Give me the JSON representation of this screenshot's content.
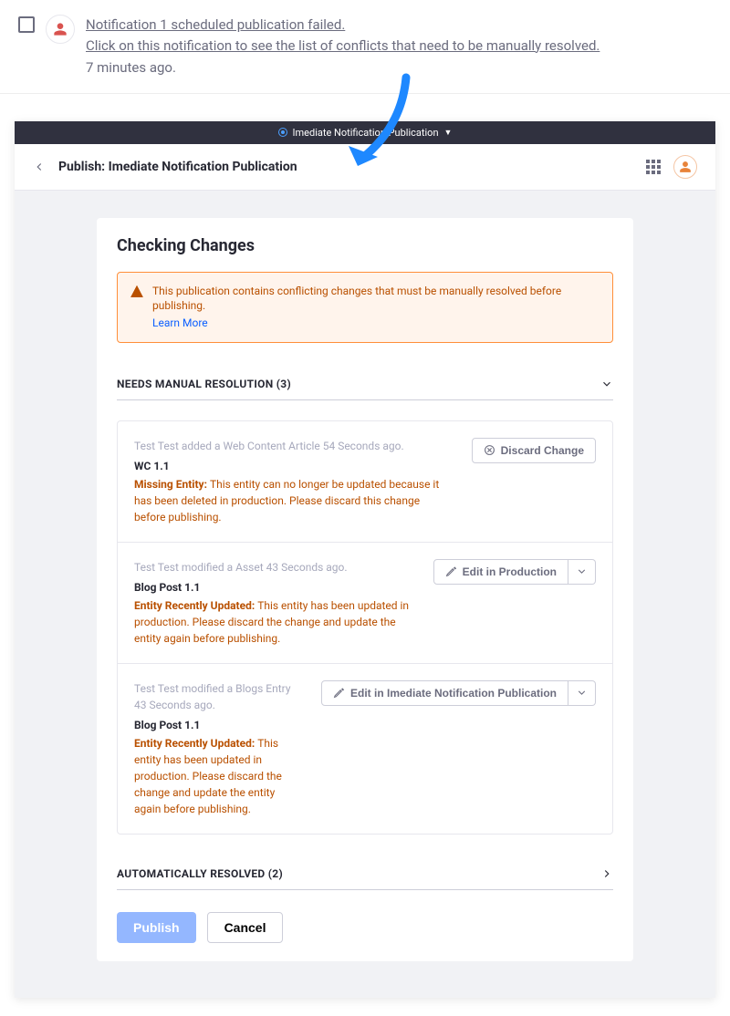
{
  "notification": {
    "line1": "Notification 1 scheduled publication failed.",
    "line2": "Click on this notification to see the list of conflicts that need to be manually resolved.",
    "time": "7 minutes ago."
  },
  "topbar": {
    "title": "Imediate Notification Publication"
  },
  "header": {
    "title": "Publish: Imediate Notification Publication"
  },
  "main": {
    "heading": "Checking Changes",
    "alert": {
      "text": "This publication contains conflicting changes that must be manually resolved before publishing.",
      "learn_more": "Learn More"
    },
    "manual_section": {
      "label": "NEEDS MANUAL RESOLUTION (3)"
    },
    "auto_section": {
      "label": "AUTOMATICALLY RESOLVED (2)"
    },
    "items": [
      {
        "meta": "Test Test added a Web Content Article 54 Seconds ago.",
        "title": "WC 1.1",
        "err_lead": "Missing Entity: ",
        "err_body": "This entity can no longer be updated because it has been deleted in production. Please discard this change before publishing.",
        "action_label": "Discard Change"
      },
      {
        "meta": "Test Test modified a Asset 43 Seconds ago.",
        "title": "Blog Post 1.1",
        "err_lead": "Entity Recently Updated: ",
        "err_body": "This entity has been updated in production. Please discard the change and update the entity again before publishing.",
        "action_label": "Edit in Production"
      },
      {
        "meta": "Test Test modified a Blogs Entry 43 Seconds ago.",
        "title": "Blog Post 1.1",
        "err_lead": "Entity Recently Updated: ",
        "err_body": "This entity has been updated in production. Please discard the change and update the entity again before publishing.",
        "action_label": "Edit in Imediate Notification Publication"
      }
    ],
    "publish_label": "Publish",
    "cancel_label": "Cancel"
  }
}
